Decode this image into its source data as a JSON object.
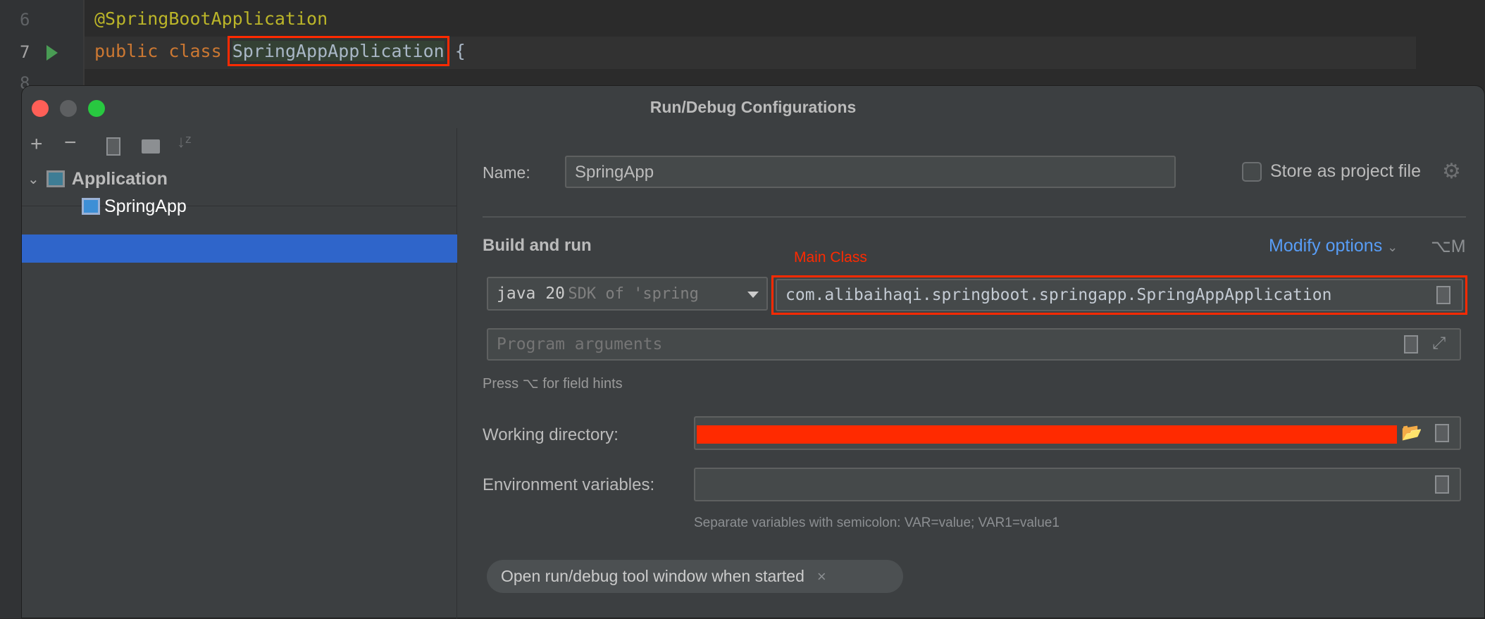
{
  "editor": {
    "lines": [
      {
        "num": "6",
        "text": "@SpringBootApplication"
      },
      {
        "num": "7",
        "keyword": "public class",
        "classname": "SpringAppApplication",
        "brace": "{"
      },
      {
        "num": "8"
      }
    ],
    "annotation_color": "#bbb529",
    "keyword_color": "#cc7832",
    "highlight_box_color": "#ff2a00"
  },
  "dialog": {
    "title": "Run/Debug Configurations",
    "toolbar": [
      "add-icon",
      "remove-icon",
      "copy-icon",
      "new-folder-icon",
      "sort-icon"
    ],
    "tree": {
      "group": "Application",
      "item": "SpringApp"
    },
    "name_label": "Name:",
    "name_value": "SpringApp",
    "store_label": "Store as project file",
    "store_checked": false,
    "section": "Build and run",
    "modify_options": "Modify options",
    "modify_shortcut": "⌥M",
    "annotation_main_class": "Main Class",
    "sdk_main": "java 20",
    "sdk_sub": "SDK of 'spring",
    "main_class": "com.alibaihaqi.springboot.springapp.SpringAppApplication",
    "program_args_placeholder": "Program arguments",
    "hint": "Press ⌥ for field hints",
    "working_dir_label": "Working directory:",
    "env_label": "Environment variables:",
    "env_hint": "Separate variables with semicolon: VAR=value; VAR1=value1",
    "chip": "Open run/debug tool window when started",
    "accent": "#589df6",
    "selection": "#2f65ca"
  }
}
